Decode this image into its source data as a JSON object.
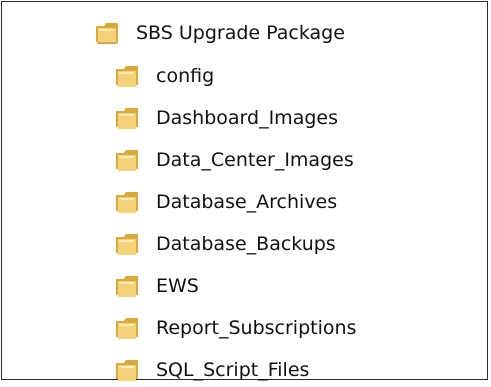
{
  "tree": {
    "root": {
      "label": "SBS Upgrade Package",
      "icon": "folder-open-icon"
    },
    "children": [
      {
        "label": "config",
        "icon": "folder-icon"
      },
      {
        "label": "Dashboard_Images",
        "icon": "folder-icon"
      },
      {
        "label": "Data_Center_Images",
        "icon": "folder-icon"
      },
      {
        "label": "Database_Archives",
        "icon": "folder-icon"
      },
      {
        "label": "Database_Backups",
        "icon": "folder-icon"
      },
      {
        "label": "EWS",
        "icon": "folder-icon"
      },
      {
        "label": "Report_Subscriptions",
        "icon": "folder-icon"
      },
      {
        "label": "SQL_Script_Files",
        "icon": "folder-icon"
      }
    ]
  },
  "colors": {
    "folder_back": "#d9a93b",
    "folder_front": "#f3d27a",
    "folder_highlight": "#fff1bf",
    "text": "#111111",
    "border": "#2b2b2b"
  }
}
